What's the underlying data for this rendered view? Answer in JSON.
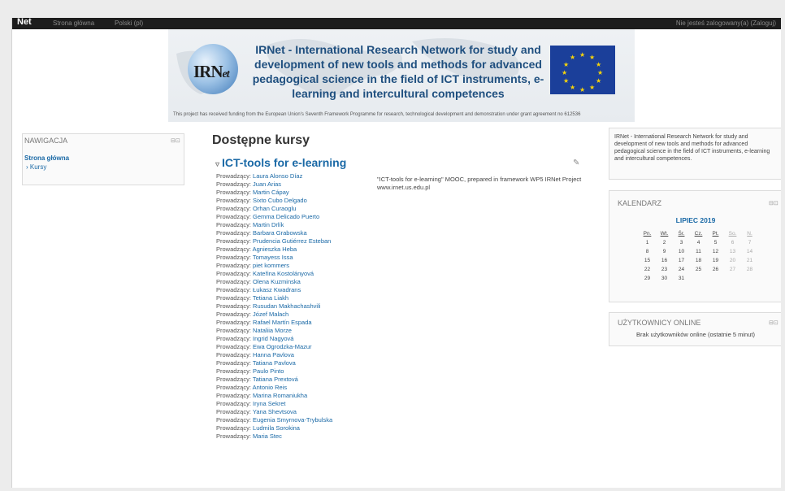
{
  "topbar": {
    "brand": "Net",
    "menu": [
      "Strona główna",
      "Polski (pl)"
    ],
    "login": "Nie jesteś zalogowany(a) (Zaloguj)"
  },
  "banner": {
    "logo_text": "IRN",
    "logo_suffix": "et",
    "title": "IRNet - International Research Network for study and development of new tools and methods for advanced pedagogical science in the field of ICT instruments, e-learning and intercultural competences",
    "funding": "This project has received funding from the European Union's Seventh Framework Programme for research, technological development and demonstration under grant agreement no 612536"
  },
  "navigation": {
    "title": "NAWIGACJA",
    "home": "Strona główna",
    "courses": "Kursy"
  },
  "main": {
    "title": "Dostępne kursy",
    "course": {
      "name": "ICT-tools for e-learning",
      "description": "\"ICT-tools for e-learning\" MOOC, prepared in framework WP5 IRNet Project www.irnet.us.edu.pl",
      "teacher_role": "Prowadzący:",
      "teachers": [
        "Laura Alonso Díaz",
        "Juan Arias",
        "Martin Cápay",
        "Sixto Cubo Delgado",
        "Orhan Curaoglu",
        "Gemma Delicado Puerto",
        "Martin Drlík",
        "Barbara Grabowska",
        "Prudencia Gutiérrez Esteban",
        "Agnieszka Heba",
        "Tomayess Issa",
        "piet kommers",
        "Kateřina Kostolányová",
        "Olena Kuzminska",
        "Łukasz Kwadrans",
        "Tetiana Liakh",
        "Rusudan Makhachashvili",
        "Józef Malach",
        "Rafael Martín Espada",
        "Nataliia Morze",
        "Ingrid Nagyová",
        "Ewa Ogrodzka-Mazur",
        "Hanna Pavlova",
        "Tatiana Pavlova",
        "Paulo Pinto",
        "Tatiana Prextová",
        "Antonio Reis",
        "Marina Romaniukha",
        "Iryna Sekret",
        "Yana Shevtsova",
        "Eugenia Smyrnova-Trybulska",
        "Ludmila Sorokina",
        "Maria Stec"
      ]
    }
  },
  "irnet_block": {
    "text": "IRNet - International Research Network for study and development of new tools and methods for advanced pedagogical science in the field of ICT instruments, e-learning and intercultural competences."
  },
  "calendar": {
    "title": "KALENDARZ",
    "month": "LIPIEC 2019",
    "days": [
      "Pn.",
      "Wt.",
      "Śr.",
      "Cz.",
      "Pt.",
      "So.",
      "N."
    ],
    "weeks": [
      [
        "1",
        "2",
        "3",
        "4",
        "5",
        "6",
        "7"
      ],
      [
        "8",
        "9",
        "10",
        "11",
        "12",
        "13",
        "14"
      ],
      [
        "15",
        "16",
        "17",
        "18",
        "19",
        "20",
        "21"
      ],
      [
        "22",
        "23",
        "24",
        "25",
        "26",
        "27",
        "28"
      ],
      [
        "29",
        "30",
        "31",
        "",
        "",
        "",
        ""
      ]
    ]
  },
  "online": {
    "title": "UŻYTKOWNICY ONLINE",
    "message": "Brak użytkowników online (ostatnie 5 minut)"
  },
  "block_controls": "⊟⊡",
  "edit_icon": "✎"
}
